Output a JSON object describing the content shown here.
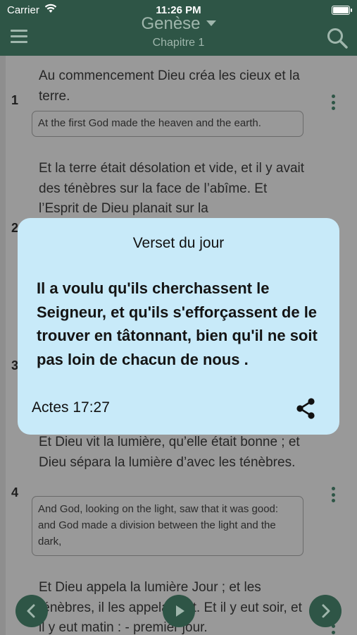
{
  "status_bar": {
    "carrier": "Carrier",
    "time": "11:26 PM"
  },
  "nav": {
    "title": "Genèse",
    "subtitle": "Chapitre 1"
  },
  "verses": [
    {
      "num": "1",
      "fr": "Au commencement Dieu créa les cieux et la terre.",
      "en": "At the first God made the heaven and the earth."
    },
    {
      "num": "2",
      "fr": "Et la terre était désolation et vide, et il y avait des ténèbres sur la face de l’abîme. Et l’Esprit de Dieu planait sur la"
    },
    {
      "num": "3"
    },
    {
      "num": "4",
      "fr": "Et Dieu vit la lumière, qu’elle était bonne ; et Dieu sépara la lumière d’avec les ténèbres.",
      "en": "And God, looking on the light, saw that it was good: and God made a division between the light and the dark,"
    },
    {
      "fr": "Et Dieu appela la lumière Jour ; et les ténèbres, il les appela Nuit. Et il y eut soir, et il y eut matin : - premier jour."
    }
  ],
  "popup": {
    "title": "Verset du jour",
    "text": "Il a voulu qu'ils cherchassent le Seigneur, et qu'ils s'efforçassent de le trouver en tâtonnant, bien qu'il ne soit pas loin de chacun de nous .",
    "reference": "Actes 17:27"
  },
  "colors": {
    "accent": "#2e5546",
    "popup_bg": "#c8eaf9",
    "dimmed_bg": "#999999"
  }
}
